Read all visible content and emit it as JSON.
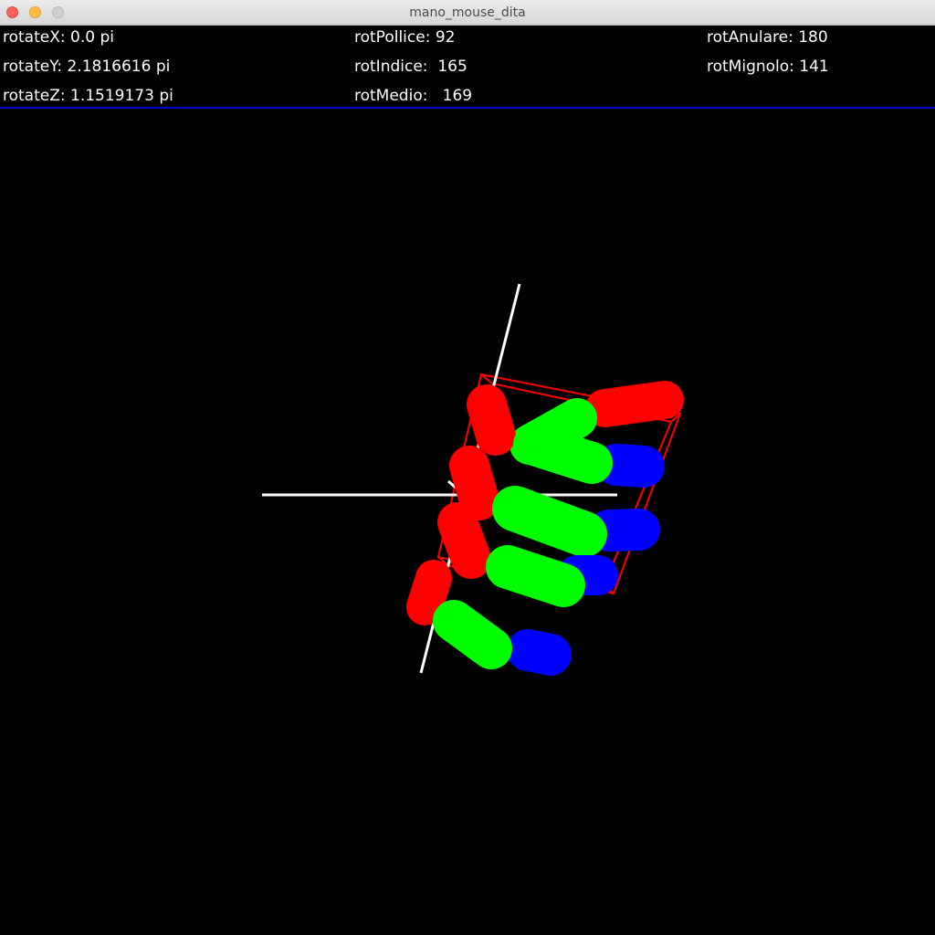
{
  "window": {
    "title": "mano_mouse_dita"
  },
  "hud": {
    "rotate_x": "rotateX: 0.0 pi",
    "rotate_y": "rotateY: 2.1816616 pi",
    "rotate_z": "rotateZ: 1.1519173 pi",
    "rot_pollice": "rotPollice: 92",
    "rot_indice": "rotIndice:  165",
    "rot_medio": "rotMedio:   169",
    "rot_anulare": "rotAnulare: 180",
    "rot_mignolo": "rotMignolo: 141",
    "separator_color": "#0000cc"
  },
  "scene": {
    "background_color": "#000000",
    "axis_color": "#ffffff",
    "box_color": "#ff0000",
    "segment_colors": {
      "proximal": "#ff0000",
      "middle": "#00ff00",
      "distal": "#0000ff"
    }
  }
}
